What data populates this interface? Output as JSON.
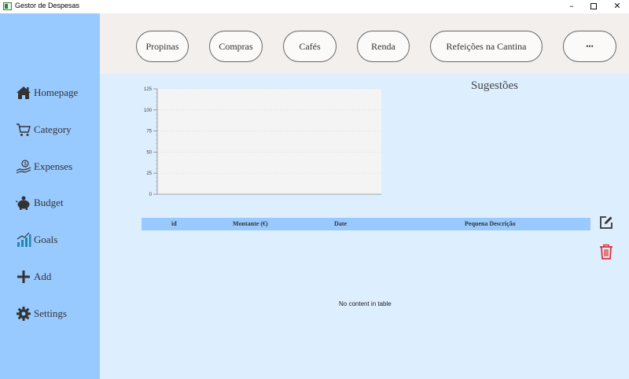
{
  "window": {
    "title": "Gestor de Despesas",
    "minimize_glyph": "–",
    "close_glyph": "✕"
  },
  "sidebar": {
    "items": [
      {
        "label": "Homepage",
        "icon": "home-icon"
      },
      {
        "label": "Category",
        "icon": "cart-icon"
      },
      {
        "label": "Expenses",
        "icon": "money-hand-icon"
      },
      {
        "label": "Budget",
        "icon": "piggy-bank-icon"
      },
      {
        "label": "Goals",
        "icon": "bar-chart-icon"
      },
      {
        "label": "Add",
        "icon": "plus-icon"
      },
      {
        "label": "Settings",
        "icon": "gear-icon"
      }
    ]
  },
  "categories": [
    "Propinas",
    "Compras",
    "Cafés",
    "Renda",
    "Refeições na Cantina",
    "•••"
  ],
  "main": {
    "suggestions_title": "Sugestões"
  },
  "chart_data": {
    "type": "bar",
    "categories": [],
    "values": [],
    "title": "",
    "xlabel": "",
    "ylabel": "",
    "ylim": [
      0,
      125
    ],
    "yticks": [
      "125",
      "100",
      "75",
      "50",
      "25",
      "0"
    ],
    "grid": true
  },
  "table": {
    "columns": [
      "id",
      "Montante (€)",
      "Date",
      "Pequena Descrição"
    ],
    "rows": [],
    "empty_text": "No content in table"
  },
  "colors": {
    "sidebar": "#99caff",
    "main_bg": "#ddeeff",
    "topbar": "#f3efec",
    "delete_icon": "#e03131"
  }
}
